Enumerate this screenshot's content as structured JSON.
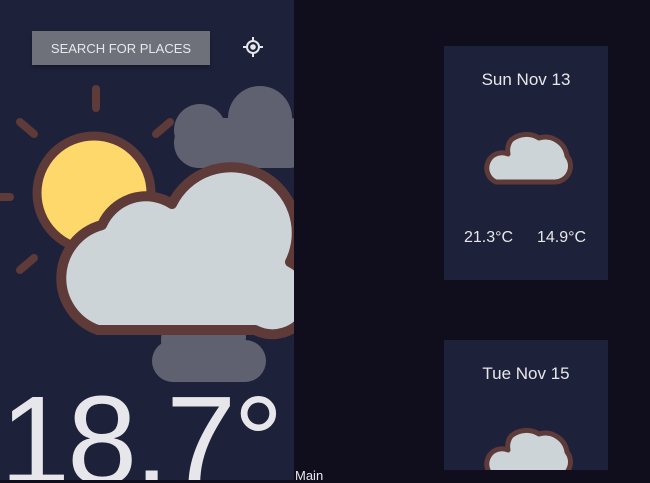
{
  "sidebar": {
    "search_label": "SEARCH FOR PLACES",
    "locate_icon": "crosshair-icon",
    "weather_icon": "sun-behind-clouds-icon",
    "temperature": "18.7°"
  },
  "main": {
    "label": "Main",
    "forecast": [
      {
        "date": "Sun Nov 13",
        "icon": "cloud-icon",
        "max": "21.3°C",
        "min": "14.9°C"
      },
      {
        "date": "Tue Nov 15",
        "icon": "cloud-icon"
      }
    ]
  },
  "colors": {
    "sidebar_bg": "#1e213a",
    "page_bg": "#100e1d",
    "button_bg": "#6e707a",
    "text": "#e7e7eb",
    "sun": "#ffd86b",
    "cloud": "#cdd4d8",
    "outline": "#5e3a39",
    "back_cloud": "#5f6171"
  }
}
